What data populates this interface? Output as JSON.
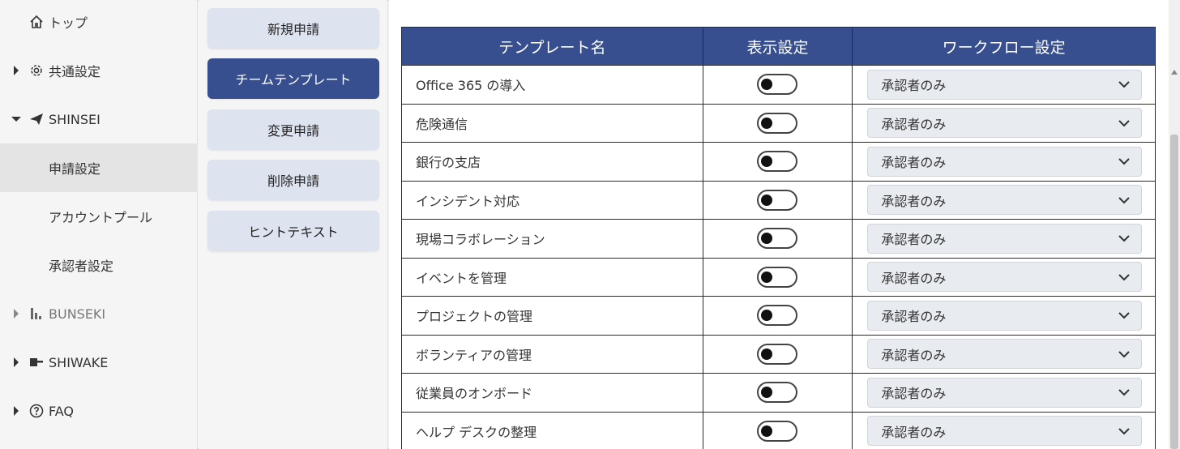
{
  "sidebar": {
    "items": [
      {
        "label": "トップ",
        "icon": "home-icon"
      },
      {
        "label": "共通設定",
        "icon": "gear-icon"
      },
      {
        "label": "SHINSEI",
        "icon": "paper-plane-icon"
      },
      {
        "label": "申請設定"
      },
      {
        "label": "アカウントプール"
      },
      {
        "label": "承認者設定"
      },
      {
        "label": "BUNSEKI",
        "icon": "bar-chart-icon"
      },
      {
        "label": "SHIWAKE",
        "icon": "split-icon"
      },
      {
        "label": "FAQ",
        "icon": "question-circle-icon"
      }
    ]
  },
  "tabs": [
    {
      "label": "新規申請"
    },
    {
      "label": "チームテンプレート"
    },
    {
      "label": "変更申請"
    },
    {
      "label": "削除申請"
    },
    {
      "label": "ヒントテキスト"
    }
  ],
  "table": {
    "headers": [
      "テンプレート名",
      "表示設定",
      "ワークフロー設定"
    ],
    "rows": [
      {
        "name": "Office 365 の導入",
        "workflow": "承認者のみ"
      },
      {
        "name": "危険通信",
        "workflow": "承認者のみ"
      },
      {
        "name": "銀行の支店",
        "workflow": "承認者のみ"
      },
      {
        "name": "インシデント対応",
        "workflow": "承認者のみ"
      },
      {
        "name": "現場コラボレーション",
        "workflow": "承認者のみ"
      },
      {
        "name": "イベントを管理",
        "workflow": "承認者のみ"
      },
      {
        "name": "プロジェクトの管理",
        "workflow": "承認者のみ"
      },
      {
        "name": "ボランティアの管理",
        "workflow": "承認者のみ"
      },
      {
        "name": "従業員のオンボード",
        "workflow": "承認者のみ"
      },
      {
        "name": "ヘルプ デスクの整理",
        "workflow": "承認者のみ"
      }
    ]
  },
  "colors": {
    "accent": "#374f8e",
    "tab_bg": "#dde3ef"
  }
}
